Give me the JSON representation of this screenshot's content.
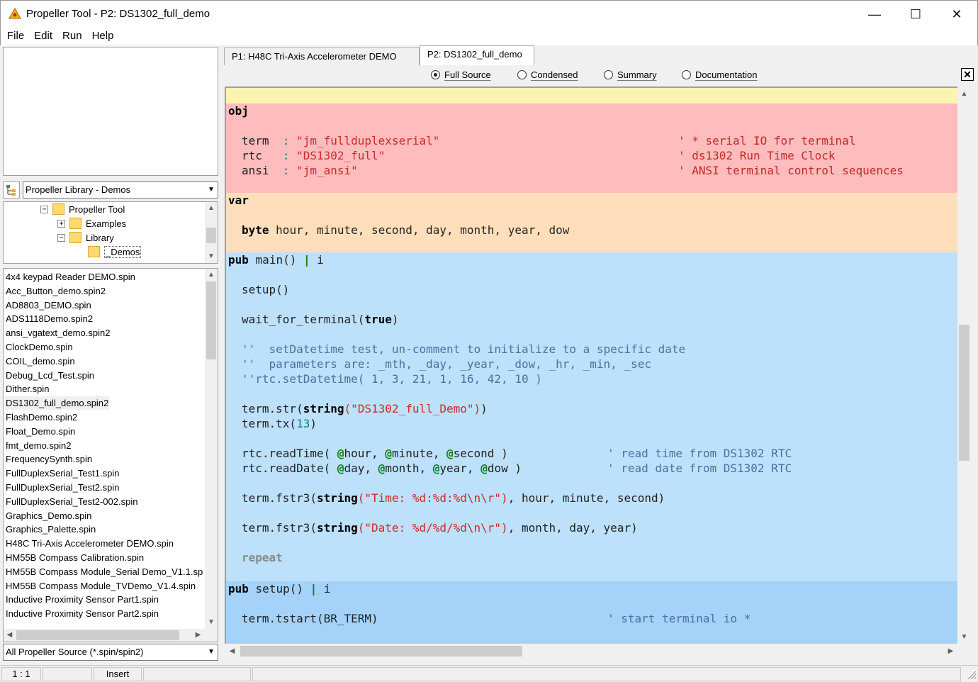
{
  "window": {
    "title": "Propeller Tool - P2: DS1302_full_demo",
    "minimize_glyph": "—",
    "maximize_glyph": "☐",
    "close_glyph": "✕"
  },
  "menu": [
    "File",
    "Edit",
    "Run",
    "Help"
  ],
  "library": {
    "selected": "Propeller Library - Demos"
  },
  "tree": [
    {
      "label": "Propeller Tool",
      "expander": "⊟"
    },
    {
      "label": "Examples",
      "expander": "⊞"
    },
    {
      "label": "Library",
      "expander": "⊟"
    },
    {
      "label": "_Demos",
      "expander": ""
    }
  ],
  "files": [
    "4x4 keypad Reader DEMO.spin",
    "Acc_Button_demo.spin2",
    "AD8803_DEMO.spin",
    "ADS1118Demo.spin2",
    "ansi_vgatext_demo.spin2",
    "ClockDemo.spin",
    "COIL_demo.spin",
    "Debug_Lcd_Test.spin",
    "Dither.spin",
    "DS1302_full_demo.spin2",
    "FlashDemo.spin2",
    "Float_Demo.spin",
    "fmt_demo.spin2",
    "FrequencySynth.spin",
    "FullDuplexSerial_Test1.spin",
    "FullDuplexSerial_Test2.spin",
    "FullDuplexSerial_Test2-002.spin",
    "Graphics_Demo.spin",
    "Graphics_Palette.spin",
    "H48C Tri-Axis Accelerometer DEMO.spin",
    "HM55B Compass Calibration.spin",
    "HM55B Compass Module_Serial Demo_V1.1.sp",
    "HM55B Compass Module_TVDemo_V1.4.spin",
    "Inductive Proximity Sensor Part1.spin",
    "Inductive Proximity Sensor Part2.spin"
  ],
  "selected_file": "DS1302_full_demo.spin2",
  "filter": "All Propeller Source (*.spin/spin2)",
  "tabs": [
    {
      "label": "P1: H48C Tri-Axis Accelerometer DEMO",
      "active": false
    },
    {
      "label": "P2: DS1302_full_demo",
      "active": true
    }
  ],
  "view_modes": [
    {
      "label": "Full Source",
      "checked": true
    },
    {
      "label": "Condensed",
      "checked": false
    },
    {
      "label": "Summary",
      "checked": false
    },
    {
      "label": "Documentation",
      "checked": false
    }
  ],
  "close_panel": "✕",
  "code": {
    "obj_kw": "obj",
    "obj_lines": [
      {
        "name": "term",
        "sep": ":",
        "value": "\"jm_fullduplexserial\"",
        "comment": "* serial IO for terminal"
      },
      {
        "name": "rtc",
        "sep": ":",
        "value": "\"DS1302_full\"",
        "comment": "ds1302 Run Time Clock"
      },
      {
        "name": "ansi",
        "sep": ":",
        "value": "\"jm_ansi\"",
        "comment": "ANSI terminal control sequences"
      }
    ],
    "var_kw": "var",
    "var_type": "byte",
    "var_names": "hour, minute, second, day, month, year, dow",
    "pub_main": {
      "kw": "pub",
      "sig": "main()",
      "bar": "|",
      "local": "i"
    },
    "main_lines": {
      "setup": "setup()",
      "wait_fn": "wait_for_terminal(",
      "wait_arg": "true",
      "wait_close": ")",
      "c1": "''  setDatetime test, un-comment to initialize to a specific date",
      "c2": "''  parameters are: _mth, _day, _year, _dow, _hr, _min, _sec",
      "c3": "''rtc.setDatetime( 1, 3, 21, 1, 16, 42, 10 )",
      "str_call": "term.str(",
      "str_kw": "string",
      "str_val": "(\"DS1302_full_Demo\")",
      "str_close": ")",
      "tx_call": "term.tx(",
      "tx_num": "13",
      "tx_close": ")",
      "rt_call": "rtc.readTime( ",
      "rt_args": [
        "hour",
        "minute",
        "second"
      ],
      "rt_close": " )",
      "rt_comment": "' read time from DS1302 RTC",
      "rd_call": "rtc.readDate( ",
      "rd_args": [
        "day",
        "month",
        "year",
        "dow"
      ],
      "rd_close": " )",
      "rd_comment": "' read date from DS1302 RTC",
      "at": "@",
      "fstr_call": "term.fstr3(",
      "fstr_kw": "string",
      "time_str": "(\"Time: %d:%d:%d\\n\\r\")",
      "time_tail": ", hour, minute, second)",
      "date_str": "(\"Date: %d/%d/%d\\n\\r\")",
      "date_tail": ", month, day, year)",
      "repeat": "repeat"
    },
    "pub_setup": {
      "kw": "pub",
      "sig": "setup()",
      "bar": "|",
      "local": "i"
    },
    "setup_lines": {
      "tstart": "term.tstart(BR_TERM)",
      "tstart_comment": "' start terminal io *"
    }
  },
  "status": {
    "position": "1 : 1",
    "mode": "Insert"
  },
  "colors": {
    "con_yellow": "#fbf4b0",
    "obj_red": "#ffbcbc",
    "var_orange": "#ffdfbb",
    "pub_blue": "#bde0fb",
    "pub_blue2": "#a4d2f9"
  }
}
